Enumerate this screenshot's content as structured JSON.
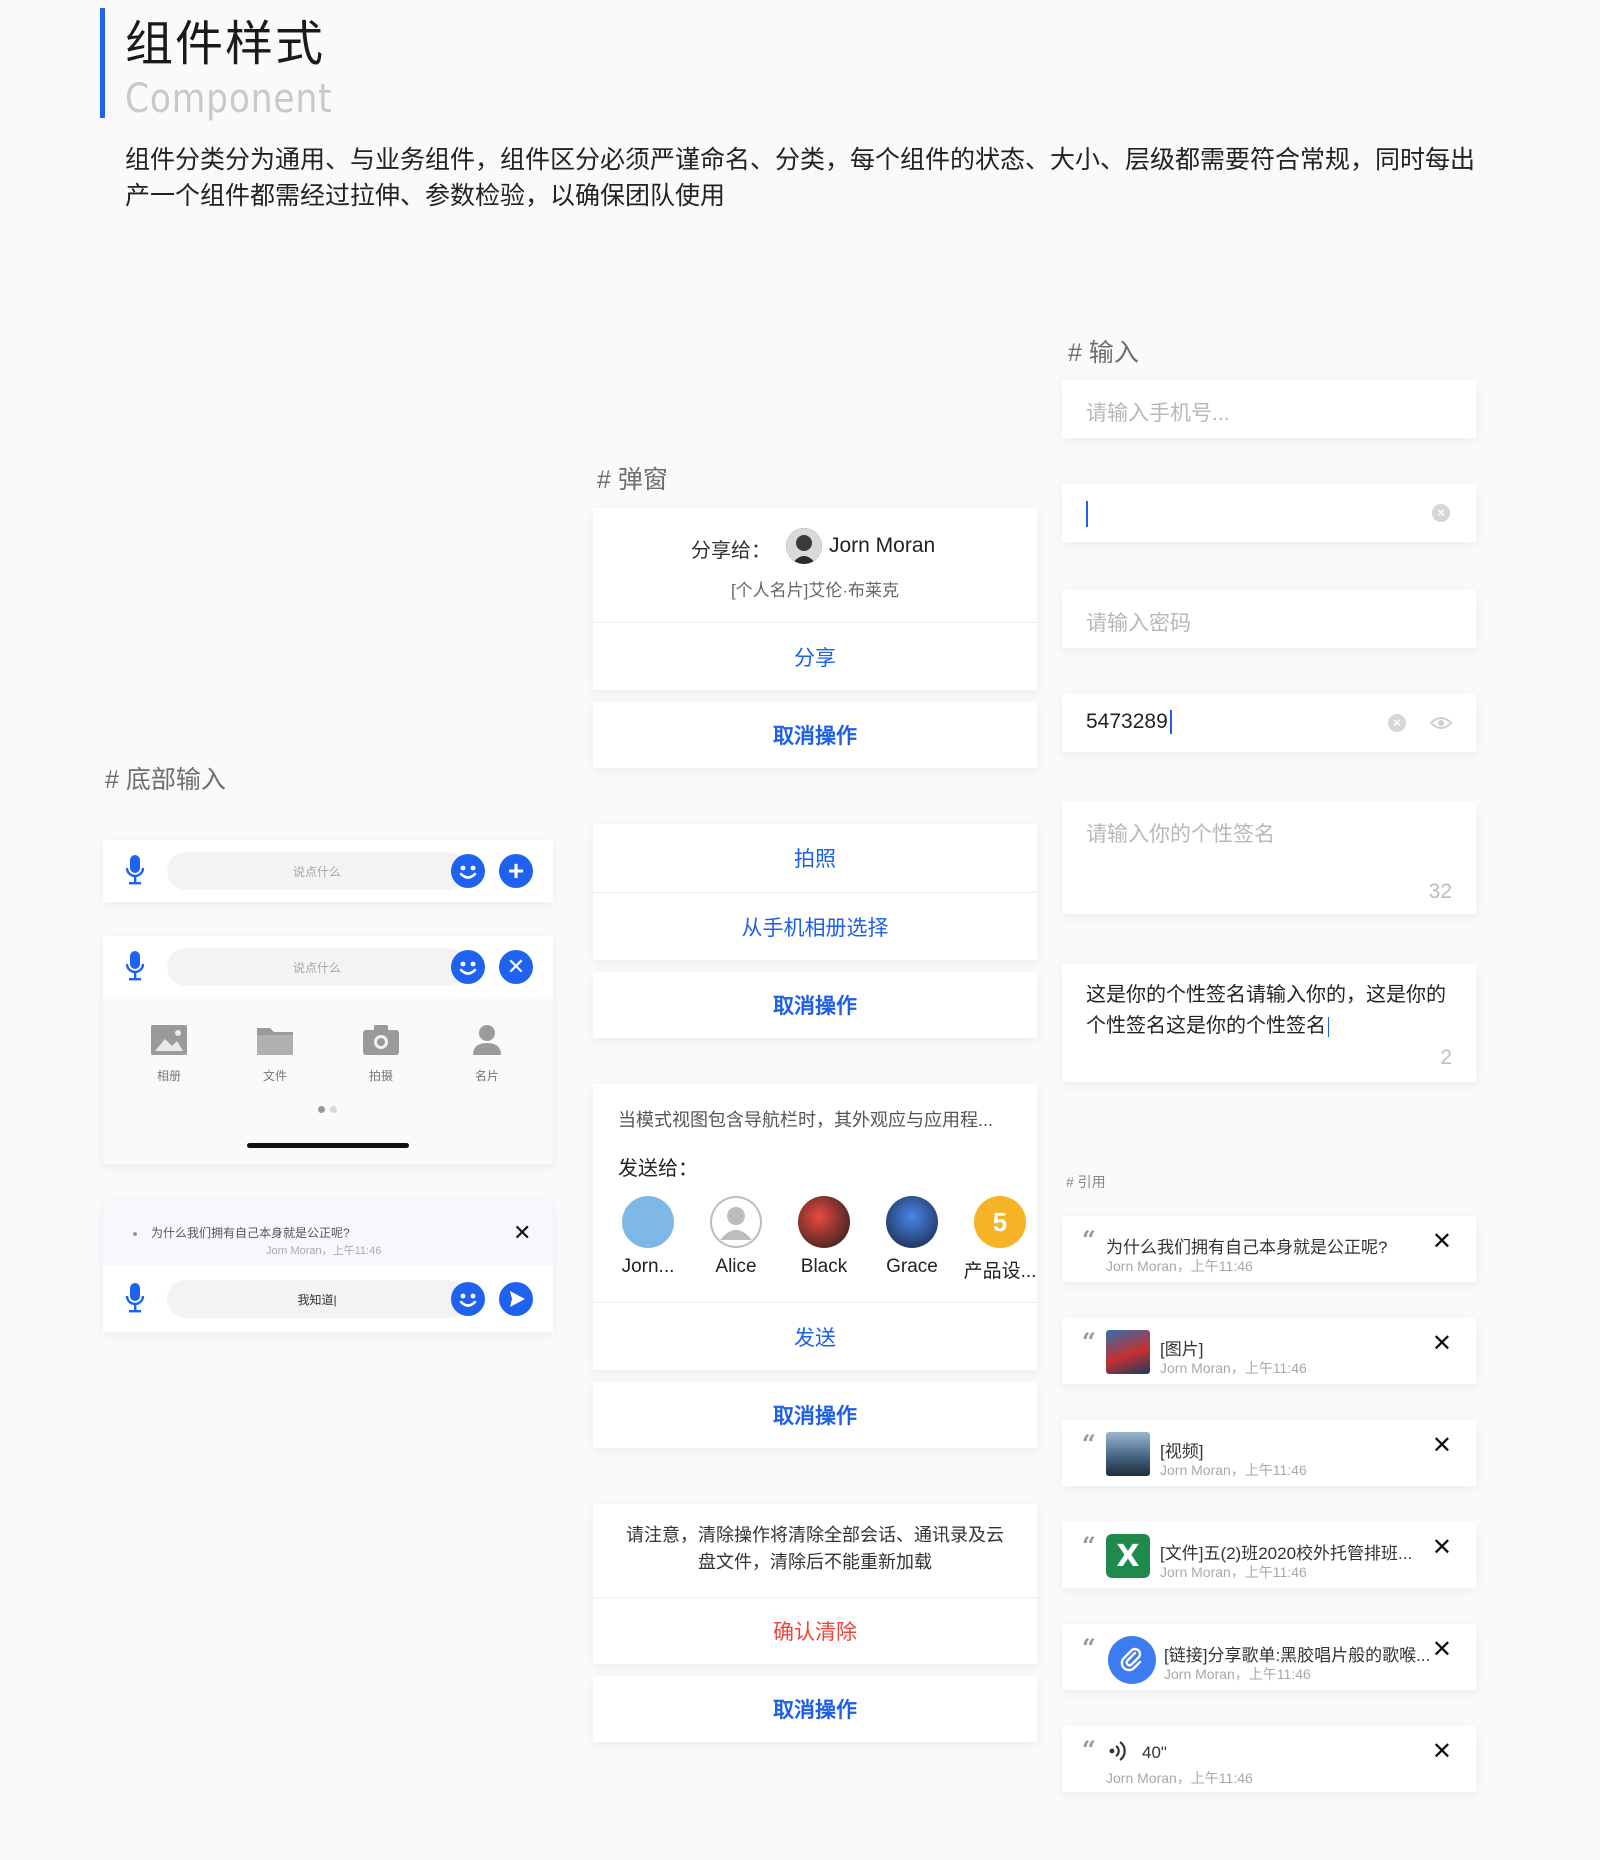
{
  "header": {
    "title": "组件样式",
    "subtitle": "Component",
    "description": "组件分类分为通用、与业务组件，组件区分必须严谨命名、分类，每个组件的状态、大小、层级都需要符合常规，同时每出产一个组件都需经过拉伸、参数检验，以确保团队使用"
  },
  "sections": {
    "bottom_input": "# 底部输入",
    "popup": "# 弹窗",
    "input": "# 输入",
    "quote": "# 引用"
  },
  "bottom_input": {
    "placeholder": "说点什么",
    "tools": [
      {
        "label": "相册",
        "icon": "image-icon"
      },
      {
        "label": "文件",
        "icon": "folder-icon"
      },
      {
        "label": "拍摄",
        "icon": "camera-icon"
      },
      {
        "label": "名片",
        "icon": "contact-icon"
      }
    ],
    "quote_text": "为什么我们拥有自己本身就是公正呢?",
    "quote_meta": "Jorn Moran，上午11:46",
    "typed_value": "我知道|"
  },
  "popup": {
    "share_to_label": "分享给：",
    "share_to_name": "Jorn Moran",
    "share_card_text": "[个人名片]艾伦·布莱克",
    "share_button": "分享",
    "cancel": "取消操作",
    "take_photo": "拍照",
    "choose_album": "从手机相册选择",
    "modal_text": "当模式视图包含导航栏时，其外观应与应用程...",
    "send_to_label": "发送给：",
    "contacts": [
      {
        "name": "Jorn...",
        "color": "#7fb7e6"
      },
      {
        "name": "Alice",
        "color": "#bdbdbd"
      },
      {
        "name": "Black",
        "color": "#c2322b"
      },
      {
        "name": "Grace",
        "color": "#2f5fb8"
      },
      {
        "name": "产品设...",
        "color": "#f5b325"
      }
    ],
    "send_button": "发送",
    "warning_text": "请注意，清除操作将清除全部会话、通讯录及云盘文件，清除后不能重新加载",
    "confirm_clear": "确认清除"
  },
  "input": {
    "phone_placeholder": "请输入手机号...",
    "password_placeholder": "请输入密码",
    "password_value": "5473289",
    "signature_placeholder": "请输入你的个性签名",
    "signature_counter": "32",
    "signature_value": "这是你的个性签名请输入你的，这是你的个性签名这是你的个性签名",
    "signature_value_counter": "2"
  },
  "quotes": [
    {
      "title": "为什么我们拥有自己本身就是公正呢?",
      "meta": "Jorn Moran，上午11:46",
      "thumb": "none"
    },
    {
      "title": "[图片]",
      "meta": "Jorn Moran，上午11:46",
      "thumb": "image"
    },
    {
      "title": "[视频]",
      "meta": "Jorn Moran，上午11:46",
      "thumb": "video"
    },
    {
      "title": "[文件]五(2)班2020校外托管排班...",
      "meta": "Jorn Moran，上午11:46",
      "thumb": "excel"
    },
    {
      "title": "[链接]分享歌单:黑胶唱片般的歌喉...",
      "meta": "Jorn Moran，上午11:46",
      "thumb": "link"
    },
    {
      "title": "40\"",
      "meta": "Jorn Moran，上午11:46",
      "thumb": "voice"
    }
  ],
  "colors": {
    "accent": "#1f62f0",
    "danger": "#f0453a",
    "background": "#fbf9fa"
  }
}
